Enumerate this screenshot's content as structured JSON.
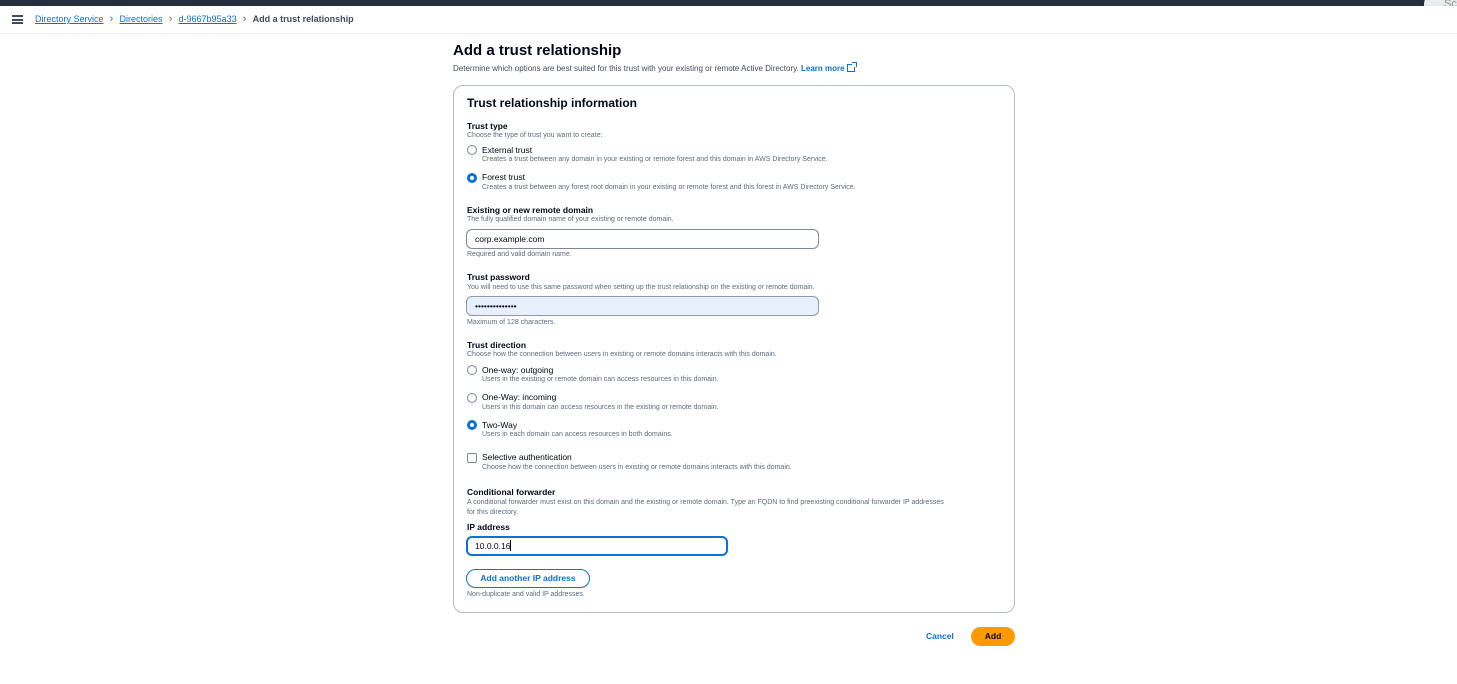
{
  "breadcrumb": {
    "items": [
      "Directory Service",
      "Directories",
      "d-9667b95a33"
    ],
    "current": "Add a trust relationship"
  },
  "corner_widget": {
    "text": "Sc"
  },
  "page": {
    "title": "Add a trust relationship",
    "description": "Determine which options are best suited for this trust with your existing or remote Active Directory.",
    "learn_more": "Learn more"
  },
  "panel": {
    "title": "Trust relationship information",
    "trust_type": {
      "label": "Trust type",
      "description": "Choose the type of trust you want to create:",
      "options": [
        {
          "label": "External trust",
          "description": "Creates a trust between any domain in your existing or remote forest and this domain in AWS Directory Service.",
          "selected": false
        },
        {
          "label": "Forest trust",
          "description": "Creates a trust between any forest root domain in your existing or remote forest and this forest in AWS Directory Service.",
          "selected": true
        }
      ]
    },
    "remote_domain": {
      "label": "Existing or new remote domain",
      "description": "The fully qualified domain name of your existing or remote domain.",
      "value": "corp.example.com",
      "constraint": "Required and valid domain name."
    },
    "trust_password": {
      "label": "Trust password",
      "description": "You will need to use this same password when setting up the trust relationship on the existing or remote domain.",
      "value": "••••••••••••••",
      "constraint": "Maximum of 128 characters."
    },
    "trust_direction": {
      "label": "Trust direction",
      "description": "Choose how the connection between users in existing or remote domains interacts with this domain.",
      "options": [
        {
          "label": "One-way: outgoing",
          "description": "Users in the existing or remote domain can access resources in this domain.",
          "selected": false
        },
        {
          "label": "One-Way: incoming",
          "description": "Users in this domain can access resources in the existing or remote domain.",
          "selected": false
        },
        {
          "label": "Two-Way",
          "description": "Users in each domain can access resources in both domains.",
          "selected": true
        }
      ]
    },
    "selective_auth": {
      "label": "Selective authentication",
      "description": "Choose how the connection between users in existing or remote domains interacts with this domain.",
      "checked": false
    },
    "conditional_forwarder": {
      "label": "Conditional forwarder",
      "description_line1": "A conditional forwarder must exist on this domain and the existing or remote domain. Type an FQDN to find preexisting conditional forwarder IP addresses",
      "description_line2": "for this directory.",
      "ip_label": "IP address",
      "ip_value": "10.0.0.16",
      "add_ip_button": "Add another IP address",
      "constraint": "Non-duplicate and valid IP addresses."
    }
  },
  "footer": {
    "cancel": "Cancel",
    "add": "Add"
  },
  "colors": {
    "accent": "#0972d3",
    "primary_button": "#ff9900",
    "top_bar": "#232f3e"
  }
}
